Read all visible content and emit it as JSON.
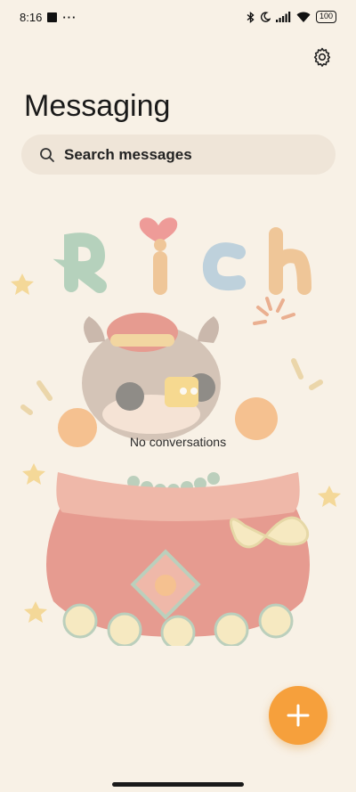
{
  "status_bar": {
    "time": "8:16",
    "overflow": "···",
    "battery": "100",
    "icons": [
      "notification-icon",
      "bluetooth-icon",
      "moon-icon",
      "signal-icon",
      "wifi-icon",
      "battery-icon"
    ]
  },
  "header": {
    "title": "Messaging",
    "settings_icon": "gear-icon"
  },
  "search": {
    "placeholder": "Search messages",
    "icon": "search-icon"
  },
  "empty_state": {
    "message": "No conversations",
    "illustration_text": "Rich"
  },
  "fab": {
    "icon": "plus-icon"
  },
  "colors": {
    "background": "#f8f1e6",
    "search_bg": "#efe5d8",
    "fab": "#f6a03c",
    "text": "#1a1a1a"
  }
}
